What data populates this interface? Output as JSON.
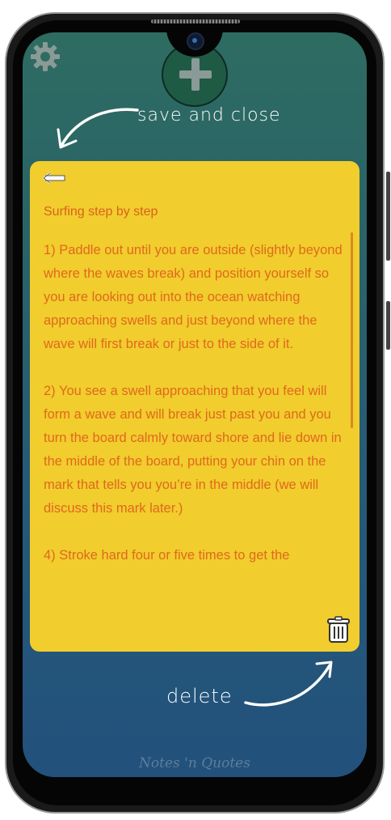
{
  "header": {
    "settings_icon": "gear-icon",
    "add_icon": "plus-icon"
  },
  "hints": {
    "save_and_close": "save and close",
    "delete": "delete"
  },
  "note": {
    "title": "Surfing step by step",
    "paragraphs": [
      "1) Paddle out until you are outside (slightly beyond where the waves break) and position yourself so you are looking out into the ocean watching approaching swells and just beyond where the wave will first break or just to the side of it.",
      "2) You see a swell approaching that you feel will form a wave and will break just past you and you turn the board calmly toward shore and lie down in the middle of the board, putting your chin on the mark that tells you you’re in the middle (we will discuss this mark later.)",
      "4) Stroke hard four or five times to get the"
    ],
    "card_color": "#f1cd2e",
    "text_color": "#e0691c"
  },
  "footer": {
    "brand": "Notes 'n Quotes"
  }
}
